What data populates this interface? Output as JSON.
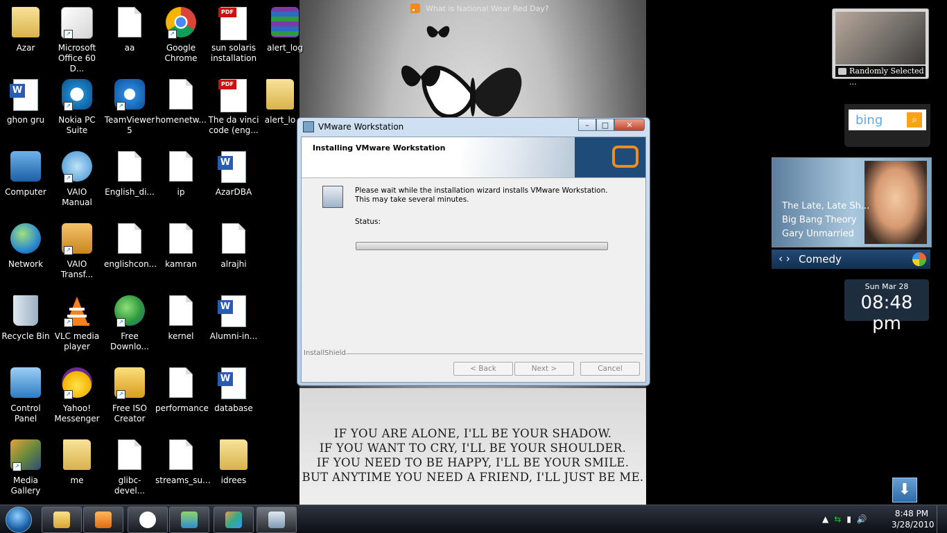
{
  "feed": {
    "title": "What is National Wear Red Day?"
  },
  "icons": [
    {
      "label": "Azar"
    },
    {
      "label": "Microsoft Office 60 D..."
    },
    {
      "label": "aa"
    },
    {
      "label": "Google Chrome"
    },
    {
      "label": "sun solaris installation"
    },
    {
      "label": "alert_log"
    },
    {
      "label": "ghon gru"
    },
    {
      "label": "Nokia PC Suite"
    },
    {
      "label": "TeamViewer 5"
    },
    {
      "label": "homenetw..."
    },
    {
      "label": "The da vinci code (eng..."
    },
    {
      "label": "alert_lo"
    },
    {
      "label": "Computer"
    },
    {
      "label": "VAIO Manual"
    },
    {
      "label": "English_di..."
    },
    {
      "label": "ip"
    },
    {
      "label": "AzarDBA"
    },
    {
      "label": "Network"
    },
    {
      "label": "VAIO Transf..."
    },
    {
      "label": "englishcon..."
    },
    {
      "label": "kamran"
    },
    {
      "label": "alrajhi"
    },
    {
      "label": "Recycle Bin"
    },
    {
      "label": "VLC media player"
    },
    {
      "label": "Free Downlo..."
    },
    {
      "label": "kernel"
    },
    {
      "label": "Alumni-in..."
    },
    {
      "label": "Control Panel"
    },
    {
      "label": "Yahoo! Messenger"
    },
    {
      "label": "Free ISO Creator"
    },
    {
      "label": "performance"
    },
    {
      "label": "database"
    },
    {
      "label": "Media Gallery"
    },
    {
      "label": "me"
    },
    {
      "label": "glibc-devel..."
    },
    {
      "label": "streams_su..."
    },
    {
      "label": "idrees"
    }
  ],
  "wallpaper": {
    "quote": [
      "IF YOU ARE ALONE, I'LL BE YOUR SHADOW.",
      "IF YOU WANT TO CRY, I'LL BE YOUR SHOULDER.",
      "IF YOU NEED TO BE HAPPY, I'LL BE YOUR SMILE.",
      "BUT ANYTIME YOU NEED A FRIEND, I'LL JUST BE ME."
    ]
  },
  "installer": {
    "window_title": "VMware Workstation",
    "heading": "Installing VMware Workstation",
    "message": "Please wait while the installation wizard installs VMware Workstation. This may take several minutes.",
    "status_label": "Status:",
    "progress": 0,
    "brand": "InstallShield",
    "back": "< Back",
    "next": "Next >",
    "cancel": "Cancel"
  },
  "gadgets": {
    "photo_caption": "Randomly Selected ...",
    "bing_logo": "bing",
    "tv_shows": [
      "The Late, Late Sh...",
      "Big Bang Theory",
      "Gary Unmarried"
    ],
    "tv_category": "Comedy",
    "clock_date": "Sun Mar 28",
    "clock_time": "08:48 pm"
  },
  "taskbar": {
    "time": "8:48 PM",
    "date": "3/28/2010",
    "pinned": [
      "windows-explorer",
      "media-player",
      "google-talk",
      "messenger",
      "paint",
      "vmware-installer"
    ]
  }
}
